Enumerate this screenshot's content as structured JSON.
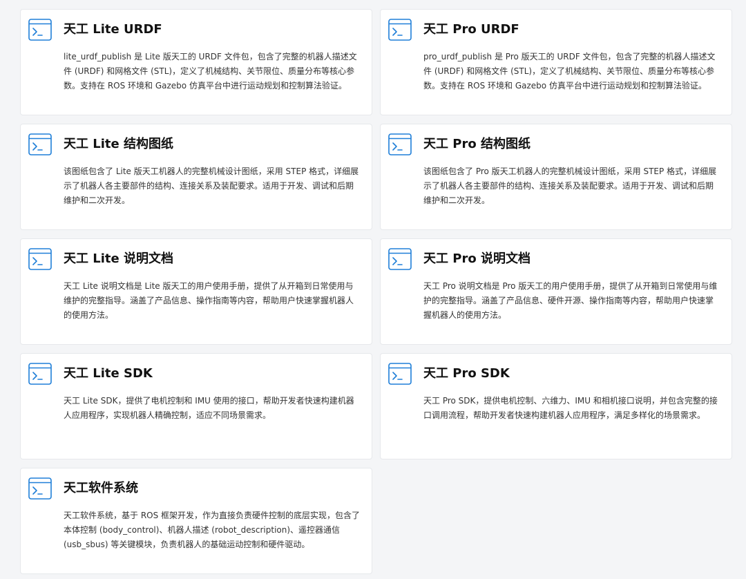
{
  "colors": {
    "accent": "#1e7ed8",
    "card_bg": "#ffffff",
    "page_bg": "#f4f5f7",
    "title": "#111111",
    "text": "#333333"
  },
  "cards": [
    {
      "icon": "terminal-icon",
      "title": "天工 Lite URDF",
      "description": "lite_urdf_publish 是 Lite 版天工的 URDF 文件包，包含了完整的机器人描述文件 (URDF) 和网格文件 (STL)，定义了机械结构、关节限位、质量分布等核心参数。支持在 ROS 环境和 Gazebo 仿真平台中进行运动规划和控制算法验证。"
    },
    {
      "icon": "terminal-icon",
      "title": "天工 Pro URDF",
      "description": "pro_urdf_publish 是 Pro 版天工的 URDF 文件包，包含了完整的机器人描述文件 (URDF) 和网格文件 (STL)，定义了机械结构、关节限位、质量分布等核心参数。支持在 ROS 环境和 Gazebo 仿真平台中进行运动规划和控制算法验证。"
    },
    {
      "icon": "terminal-icon",
      "title": "天工 Lite 结构图纸",
      "description": "该图纸包含了 Lite 版天工机器人的完整机械设计图纸，采用 STEP 格式，详细展示了机器人各主要部件的结构、连接关系及装配要求。适用于开发、调试和后期维护和二次开发。"
    },
    {
      "icon": "terminal-icon",
      "title": "天工 Pro 结构图纸",
      "description": "该图纸包含了 Pro 版天工机器人的完整机械设计图纸，采用 STEP 格式，详细展示了机器人各主要部件的结构、连接关系及装配要求。适用于开发、调试和后期维护和二次开发。"
    },
    {
      "icon": "terminal-icon",
      "title": "天工 Lite 说明文档",
      "description": "天工 Lite 说明文档是 Lite 版天工的用户使用手册，提供了从开箱到日常使用与维护的完整指导。涵盖了产品信息、操作指南等内容，帮助用户快速掌握机器人的使用方法。"
    },
    {
      "icon": "terminal-icon",
      "title": "天工 Pro 说明文档",
      "description": "天工 Pro 说明文档是 Pro 版天工的用户使用手册，提供了从开箱到日常使用与维护的完整指导。涵盖了产品信息、硬件开源、操作指南等内容，帮助用户快速掌握机器人的使用方法。"
    },
    {
      "icon": "terminal-icon",
      "title": "天工 Lite SDK",
      "description": "天工 Lite SDK，提供了电机控制和 IMU 使用的接口，帮助开发者快速构建机器人应用程序，实现机器人精确控制，适应不同场景需求。"
    },
    {
      "icon": "terminal-icon",
      "title": "天工 Pro SDK",
      "description": "天工 Pro SDK，提供电机控制、六维力、IMU 和相机接口说明，并包含完整的接口调用流程，帮助开发者快速构建机器人应用程序，满足多样化的场景需求。"
    },
    {
      "icon": "terminal-icon",
      "title": "天工软件系统",
      "description": "天工软件系统，基于 ROS 框架开发，作为直接负责硬件控制的底层实现，包含了本体控制 (body_control)、机器人描述 (robot_description)、遥控器通信 (usb_sbus) 等关键模块，负责机器人的基础运动控制和硬件驱动。"
    }
  ]
}
